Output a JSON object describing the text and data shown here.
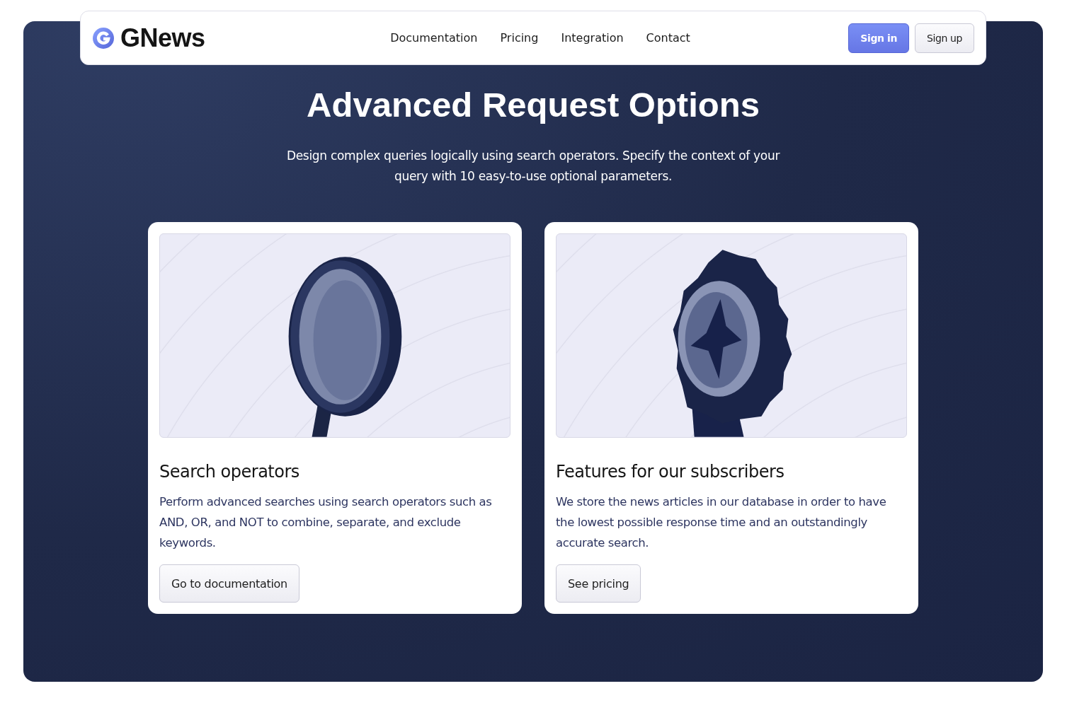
{
  "nav": {
    "brand": "GNews",
    "links": [
      "Documentation",
      "Pricing",
      "Integration",
      "Contact"
    ],
    "buttons": [
      {
        "label": "Sign in",
        "kind": "primary"
      },
      {
        "label": "Sign up",
        "kind": "secondary"
      }
    ]
  },
  "hero": {
    "title": "Advanced Request Options",
    "subtitle": "Design complex queries logically using search operators. Specify the context of your query with 10 easy-to-use optional parameters."
  },
  "cards": [
    {
      "kind": "magnifier",
      "title": "Search operators",
      "text": "Perform advanced searches using search operators such as AND, OR, and NOT to combine, separate, and exclude keywords.",
      "button": "Go to documentation"
    },
    {
      "kind": "badge",
      "title": "Features for our subscribers",
      "text": "We store the news articles in our database in order to have the lowest possible response time and an outstandingly accurate search.",
      "button": "See pricing"
    }
  ]
}
